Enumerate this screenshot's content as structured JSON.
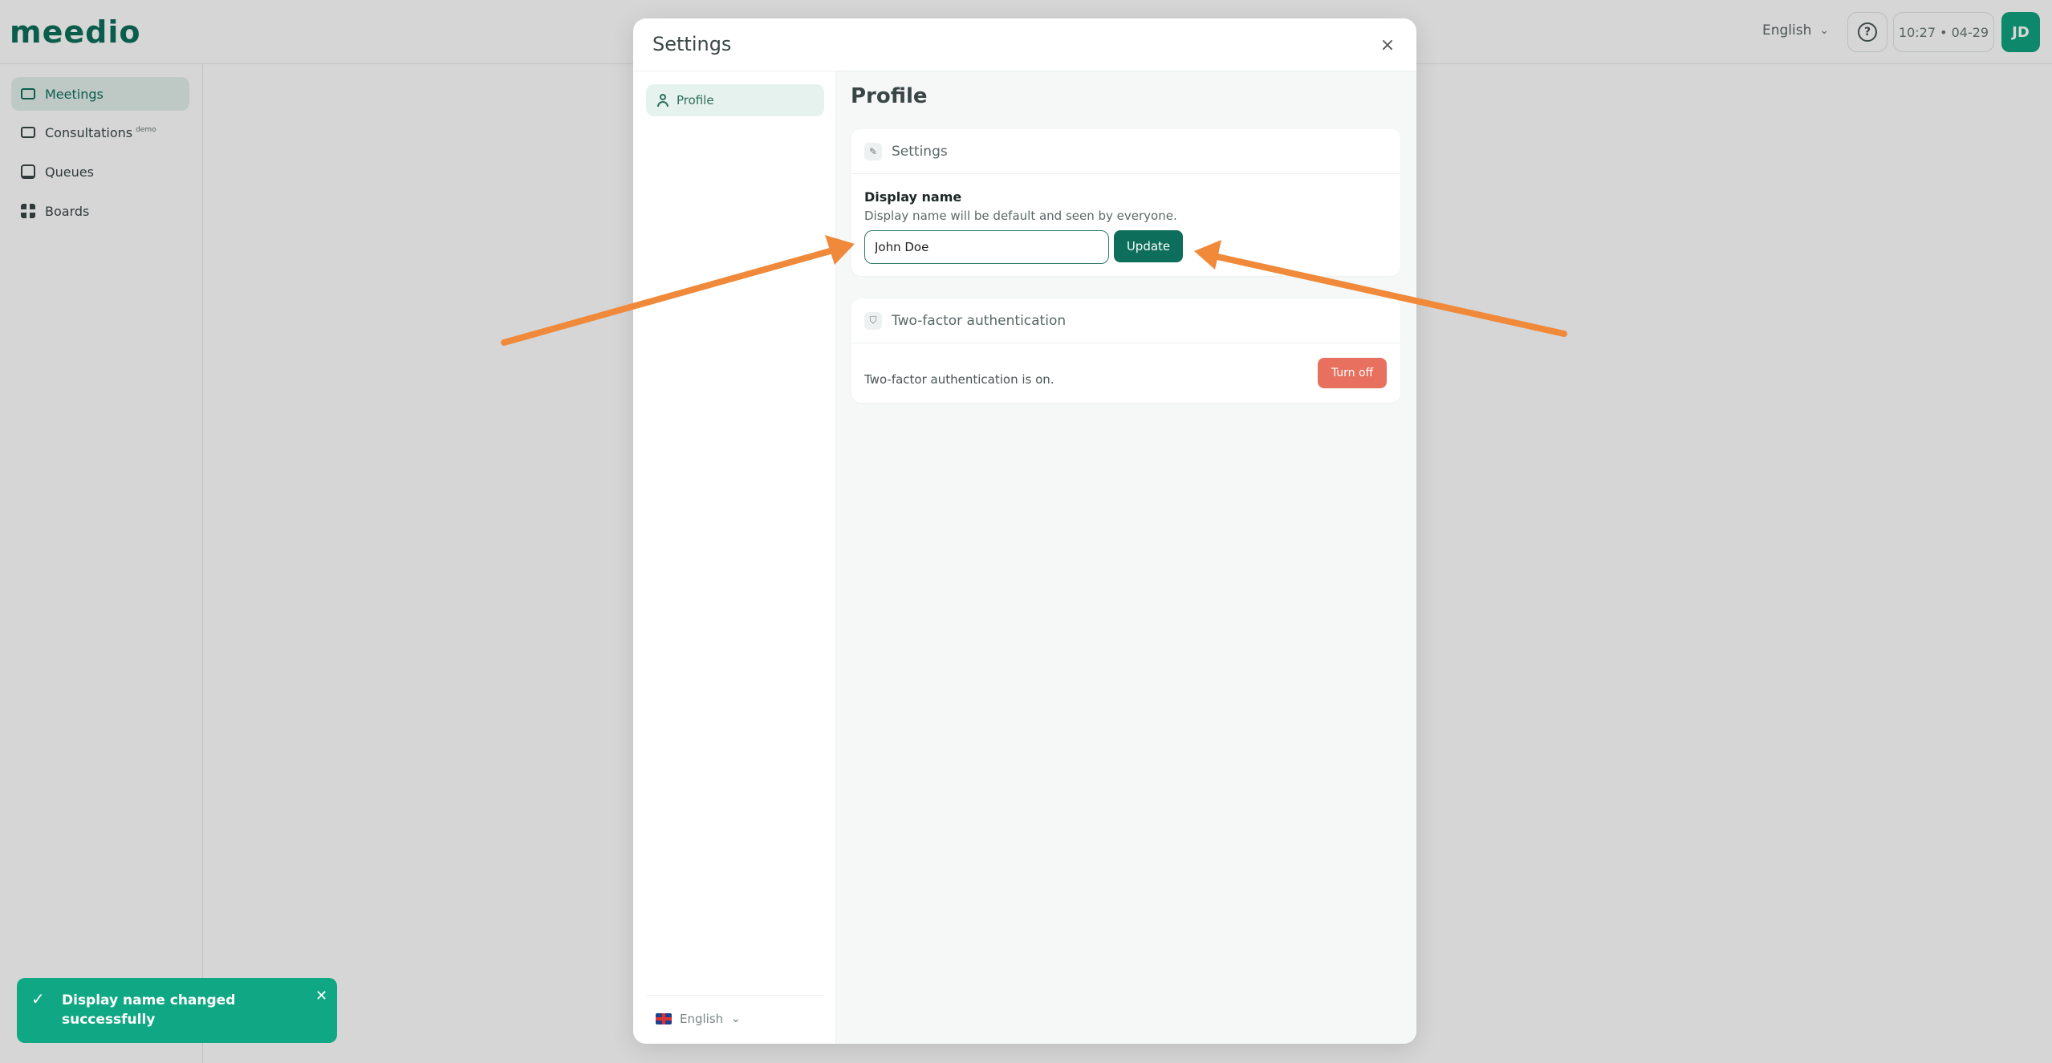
{
  "app": {
    "logo": "meedio",
    "language": "English",
    "help_symbol": "?",
    "clock": "10:27 • 04-29",
    "avatar_initials": "JD",
    "accent_color": "#10a37f"
  },
  "sidebar": {
    "items": [
      {
        "label": "Meetings",
        "icon": "video-icon",
        "active": true
      },
      {
        "label": "Consultations",
        "badge": "demo",
        "icon": "consultation-video-icon"
      },
      {
        "label": "Queues",
        "icon": "queue-icon"
      },
      {
        "label": "Boards",
        "icon": "grid-icon"
      }
    ]
  },
  "modal": {
    "title": "Settings",
    "close_symbol": "×",
    "nav": {
      "profile_label": "Profile",
      "language": "English"
    },
    "content": {
      "title": "Profile",
      "settings_card": {
        "title": "Settings",
        "field_label": "Display name",
        "field_description": "Display name will be default and seen by everyone.",
        "input_value": "John Doe",
        "update_label": "Update"
      },
      "tfa_card": {
        "title": "Two-factor authentication",
        "status": "Two-factor authentication is on.",
        "turn_off_label": "Turn off"
      }
    }
  },
  "toast": {
    "check_symbol": "✓",
    "message": "Display name changed successfully",
    "close_symbol": "✕",
    "color": "#10a884"
  },
  "annotation_color": "#f08a3a"
}
